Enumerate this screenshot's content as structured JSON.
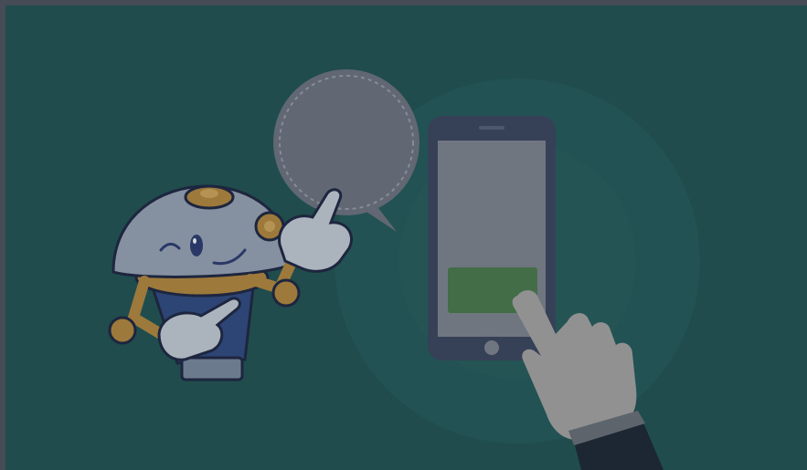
{
  "scene": {
    "description_icons": [
      "robot-mascot-icon",
      "speech-bubble-icon",
      "smartphone-icon",
      "pointing-hand-icon"
    ],
    "colors": {
      "background": "#1f5252",
      "glow": "#2a6262",
      "robot_head": "#9aa7b7",
      "robot_ring": "#b88a3c",
      "robot_body": "#2f4a82",
      "robot_eye": "#2b3a72",
      "glove": "#c9d0db",
      "bubble": "#6e7480",
      "phone_frame": "#3a4560",
      "phone_screen": "#7f8591",
      "phone_button": "#4a7a4a",
      "hand": "#a9a6a6",
      "sleeve": "#1b2432"
    }
  }
}
